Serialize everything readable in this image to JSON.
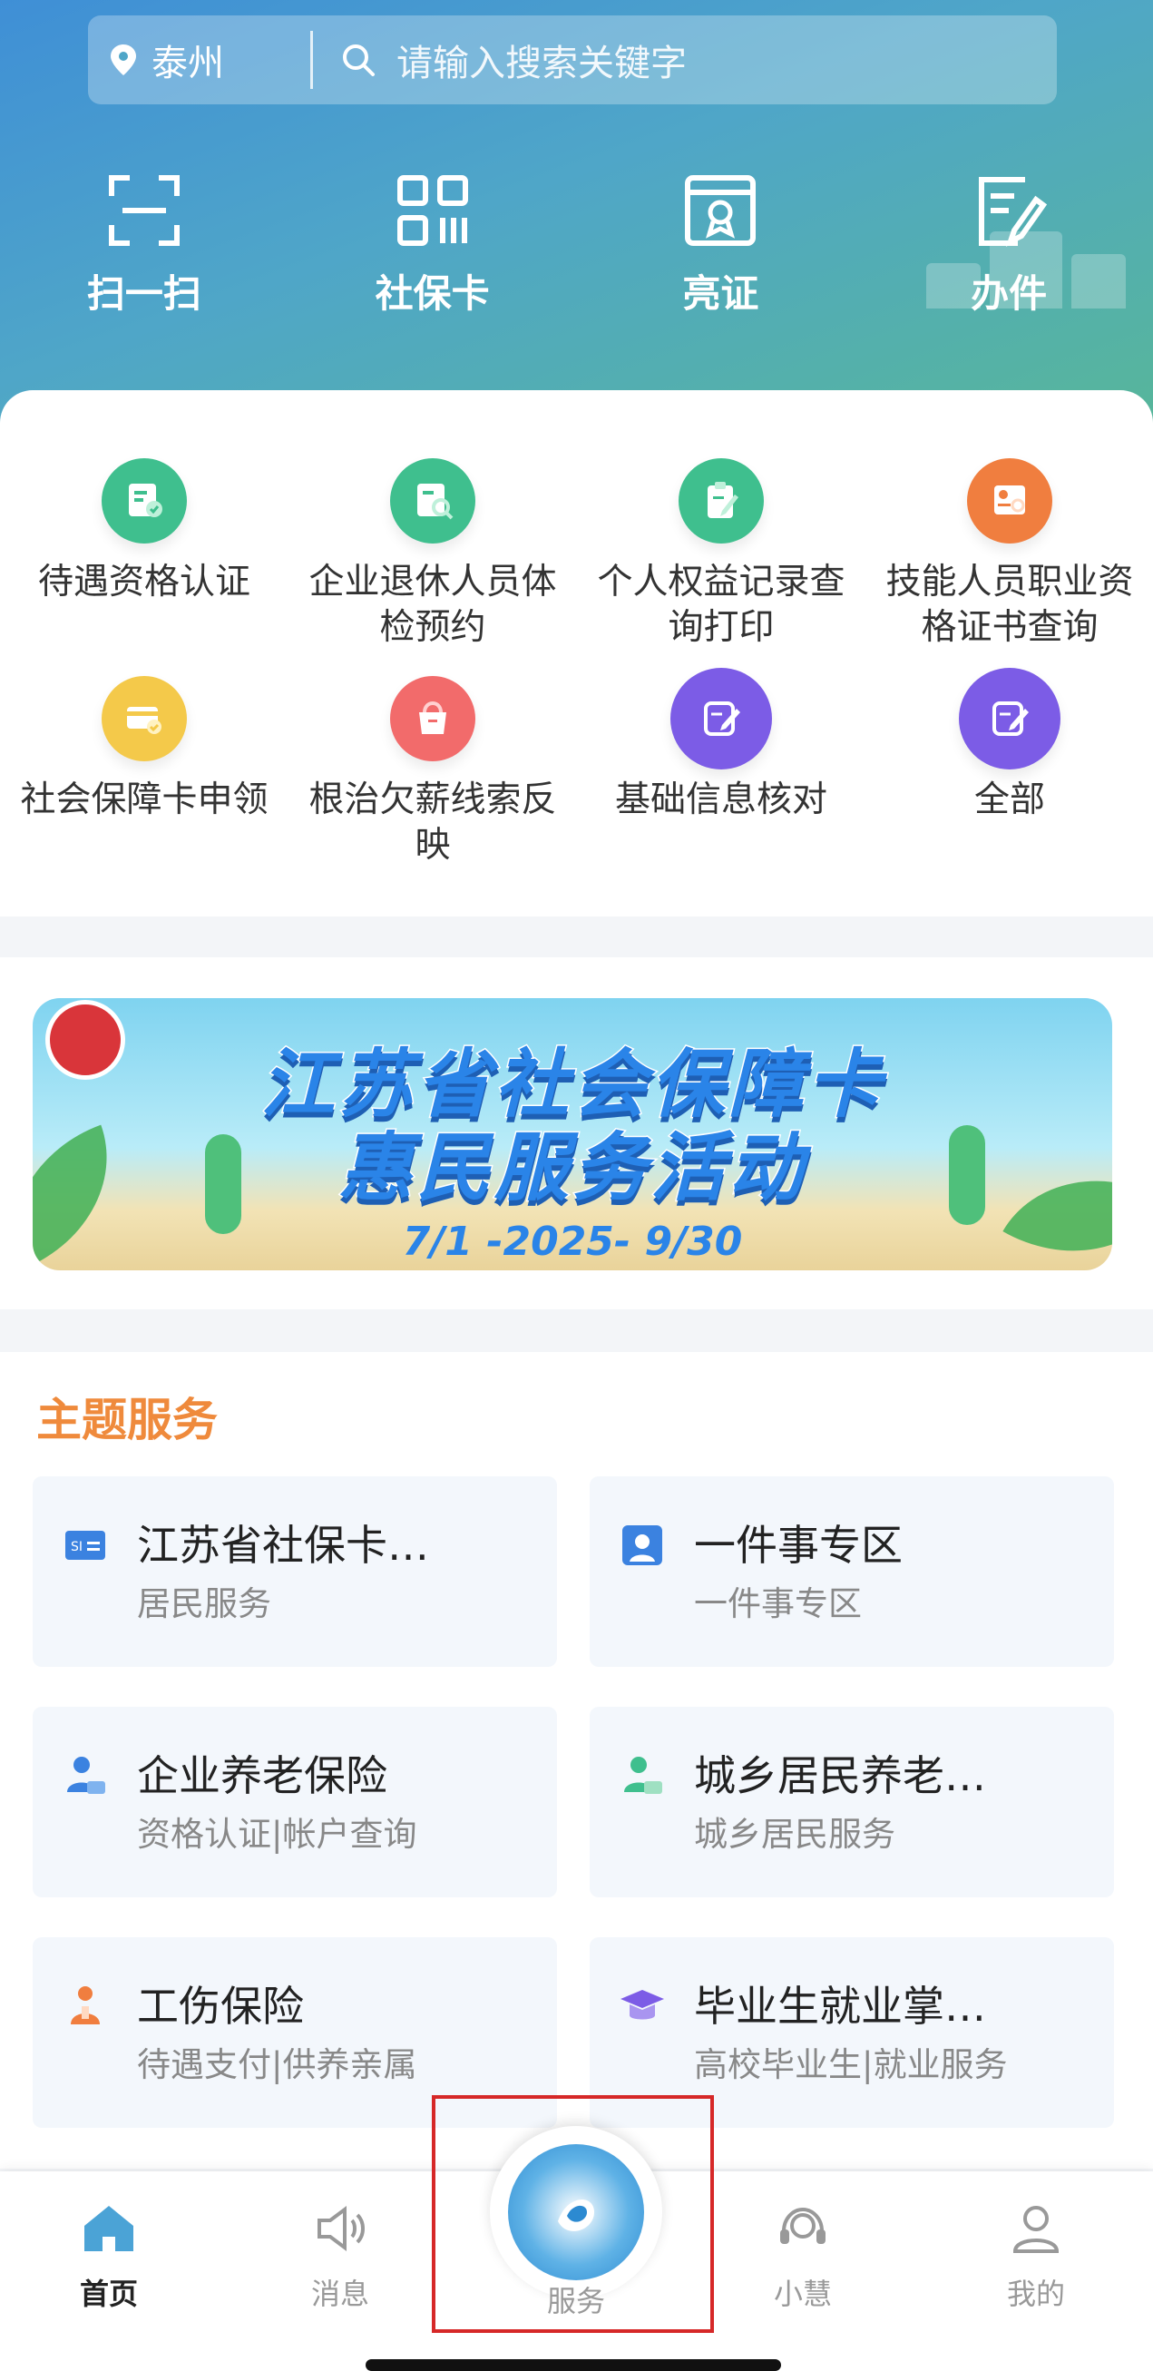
{
  "header": {
    "location": "泰州",
    "search_placeholder": "请输入搜索关键字",
    "quick_actions": [
      {
        "label": "扫一扫",
        "icon": "scan-icon"
      },
      {
        "label": "社保卡",
        "icon": "qrcode-icon"
      },
      {
        "label": "亮证",
        "icon": "certificate-icon"
      },
      {
        "label": "办件",
        "icon": "edit-doc-icon"
      }
    ]
  },
  "services": [
    {
      "label": "待遇资格认证",
      "icon": "id-check-icon",
      "color": "#3fbf8e"
    },
    {
      "label": "企业退休人员体检预约",
      "icon": "medical-exam-icon",
      "color": "#3fbf8e"
    },
    {
      "label": "个人权益记录查询打印",
      "icon": "clipboard-edit-icon",
      "color": "#3fbf8e"
    },
    {
      "label": "技能人员职业资格证书查询",
      "icon": "certificate-search-icon",
      "color": "#f07e3f"
    },
    {
      "label": "社会保障卡申领",
      "icon": "card-apply-icon",
      "color": "#f4c94a"
    },
    {
      "label": "根治欠薪线索反映",
      "icon": "wage-report-icon",
      "color": "#f26b6b"
    },
    {
      "label": "基础信息核对",
      "icon": "info-verify-icon",
      "color": "#7c5ce6"
    },
    {
      "label": "全部",
      "icon": "all-services-icon",
      "color": "#7c5ce6"
    }
  ],
  "banner": {
    "title_line1": "江苏省社会保障卡",
    "title_line2": "惠民服务活动",
    "date_range": "7/1 -2025- 9/30"
  },
  "theme": {
    "title": "主题服务",
    "cards": [
      {
        "title": "江苏省社保卡…",
        "subtitle": "居民服务",
        "icon": "si-card-icon",
        "color": "#3b82e0"
      },
      {
        "title": "一件事专区",
        "subtitle": "一件事专区",
        "icon": "person-badge-icon",
        "color": "#3b82e0"
      },
      {
        "title": "企业养老保险",
        "subtitle": "资格认证|帐户查询",
        "icon": "enterprise-pension-icon",
        "color": "#3b82e0"
      },
      {
        "title": "城乡居民养老…",
        "subtitle": "城乡居民服务",
        "icon": "resident-pension-icon",
        "color": "#3fbf8e"
      },
      {
        "title": "工伤保险",
        "subtitle": "待遇支付|供养亲属",
        "icon": "injury-insurance-icon",
        "color": "#f07e3f"
      },
      {
        "title": "毕业生就业掌…",
        "subtitle": "高校毕业生|就业服务",
        "icon": "graduate-icon",
        "color": "#7c5ce6"
      }
    ]
  },
  "tabbar": {
    "tabs": [
      {
        "label": "首页",
        "icon": "home-icon",
        "active": true
      },
      {
        "label": "消息",
        "icon": "speaker-icon",
        "active": false
      },
      {
        "label": "服务",
        "icon": "service-logo-icon",
        "active": false
      },
      {
        "label": "小慧",
        "icon": "headset-icon",
        "active": false
      },
      {
        "label": "我的",
        "icon": "user-icon",
        "active": false
      }
    ]
  }
}
